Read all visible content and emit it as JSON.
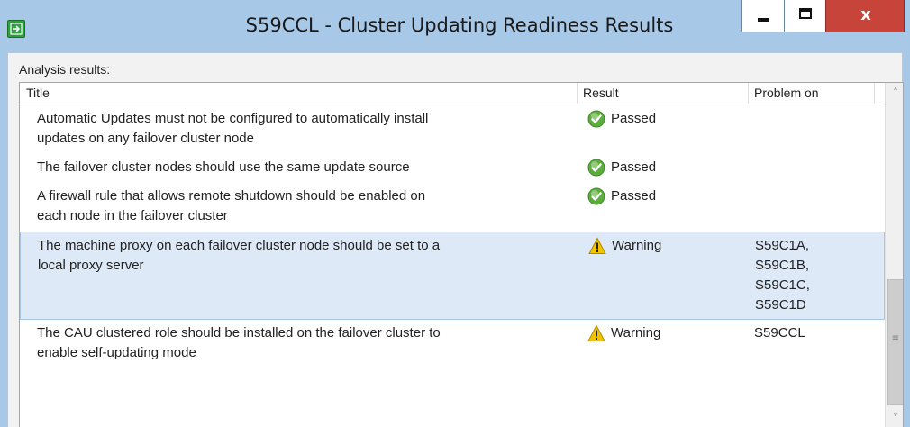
{
  "window": {
    "title": "S59CCL - Cluster Updating Readiness Results",
    "app_icon": "arrow-right-icon",
    "accent_color": "#a8c8e8",
    "close_color": "#c7443a",
    "close_glyph": "x"
  },
  "analysis_label": "Analysis results:",
  "table": {
    "columns": {
      "title": "Title",
      "result": "Result",
      "problem_on": "Problem on"
    },
    "rows": [
      {
        "title_lines": [
          "Automatic Updates must not be configured to automatically install",
          "updates on any failover cluster node"
        ],
        "result": "Passed",
        "status_icon": "check-circle-icon",
        "problem_on": []
      },
      {
        "title_lines": [
          "The failover cluster nodes should use the same update source"
        ],
        "result": "Passed",
        "status_icon": "check-circle-icon",
        "problem_on": []
      },
      {
        "title_lines": [
          "A firewall rule that allows remote shutdown should be enabled on",
          "each node in the failover cluster"
        ],
        "result": "Passed",
        "status_icon": "check-circle-icon",
        "problem_on": []
      },
      {
        "title_lines": [
          "The machine proxy on each failover cluster node should be set to a",
          "local proxy server"
        ],
        "result": "Warning",
        "status_icon": "warning-triangle-icon",
        "problem_on": [
          "S59C1A,",
          "S59C1B,",
          "S59C1C,",
          "S59C1D"
        ],
        "selected": true
      },
      {
        "title_lines": [
          "The CAU clustered role should be installed on the failover cluster to",
          "enable self-updating mode"
        ],
        "result": "Warning",
        "status_icon": "warning-triangle-icon",
        "problem_on": [
          "S59CCL"
        ]
      }
    ]
  },
  "colors": {
    "passed": "#5cae3a",
    "warning": "#f2c400",
    "selected_row": "#dde9f7"
  }
}
